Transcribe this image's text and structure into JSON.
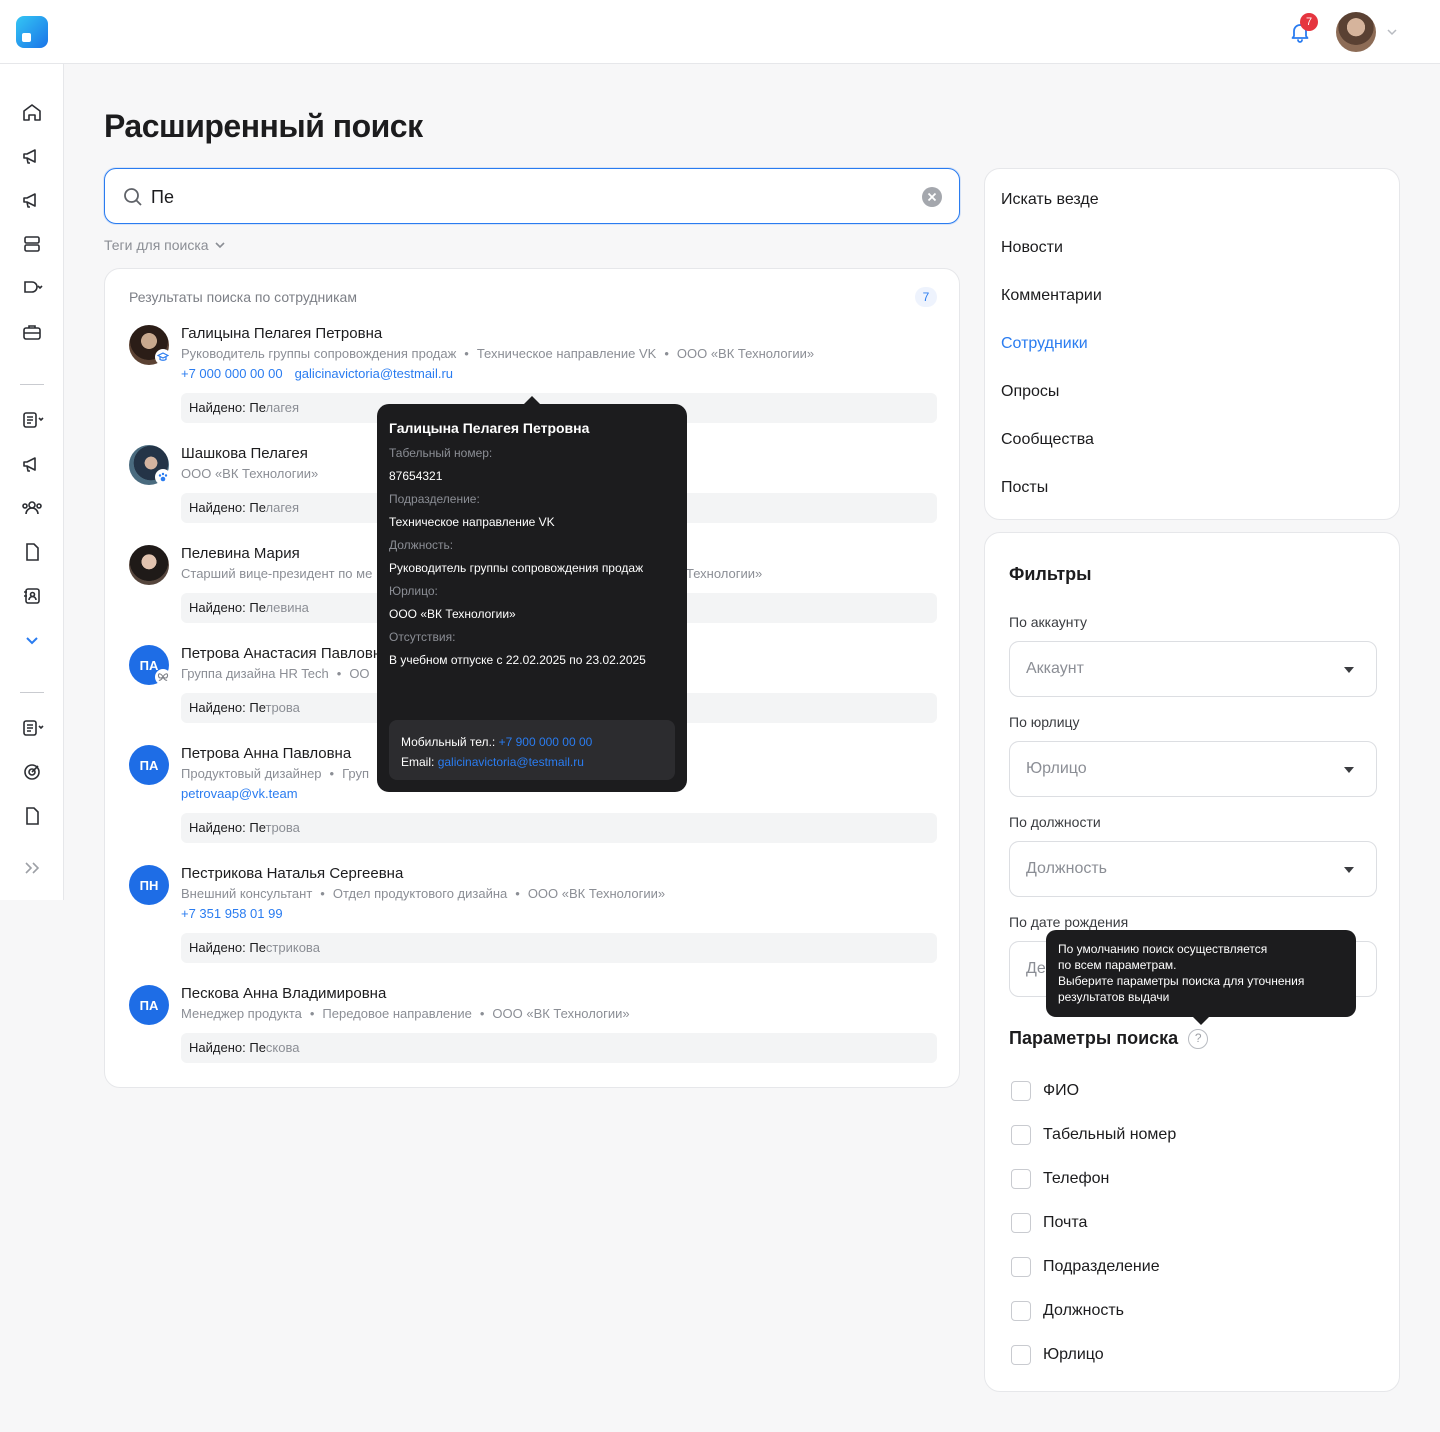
{
  "topbar": {
    "notifications_count": "7"
  },
  "page": {
    "title": "Расширенный поиск"
  },
  "search": {
    "value": "Пе",
    "tags_label": "Теги для поиска"
  },
  "results": {
    "heading": "Результаты поиска по сотрудникам",
    "count": "7",
    "people": [
      {
        "name": "Галицына Пелагея Петровна",
        "meta": [
          "Руководитель группы сопровождения продаж",
          "Техническое направление VK",
          "ООО «ВК Технологии»"
        ],
        "contacts": [
          "+7 000 000 00 00",
          "galicinavictoria@testmail.ru"
        ],
        "found_label": "Найдено:",
        "found_match": "Пе",
        "found_rest": "лагея"
      },
      {
        "name": "Шашкова Пелагея",
        "meta": [
          "ООО «ВК Технологии»"
        ],
        "contacts": [],
        "found_label": "Найдено:",
        "found_match": "Пе",
        "found_rest": "лагея"
      },
      {
        "name": "Пелевина Мария",
        "meta": [
          "Старший вице-президент по ме",
          "Технологии»"
        ],
        "contacts": [],
        "found_label": "Найдено:",
        "found_match": "Пе",
        "found_rest": "левина"
      },
      {
        "name": "Петрова Анастасия Павловн",
        "initials": "ПА",
        "meta": [
          "Группа дизайна HR Tech",
          "ОО"
        ],
        "contacts": [],
        "found_label": "Найдено:",
        "found_match": "Пе",
        "found_rest": "трова"
      },
      {
        "name": "Петрова Анна Павловна",
        "initials": "ПА",
        "meta": [
          "Продуктовый дизайнер",
          "Груп"
        ],
        "contacts": [
          "petrovaap@vk.team"
        ],
        "found_label": "Найдено:",
        "found_match": "Пе",
        "found_rest": "трова"
      },
      {
        "name": "Пестрикова Наталья Сергеевна",
        "initials": "ПН",
        "meta": [
          "Внешний консультант",
          "Отдел продуктового дизайна",
          "ООО «ВК Технологии»"
        ],
        "contacts": [
          "+7 351 958 01 99"
        ],
        "found_label": "Найдено:",
        "found_match": "Пе",
        "found_rest": "стрикова"
      },
      {
        "name": "Пескова Анна Владимировна",
        "initials": "ПА",
        "meta": [
          "Менеджер продукта",
          "Передовое направление",
          "ООО «ВК Технологии»"
        ],
        "contacts": [],
        "found_label": "Найдено:",
        "found_match": "Пе",
        "found_rest": "скова"
      }
    ]
  },
  "tooltip": {
    "name": "Галицына Пелагея Петровна",
    "tab_label": "Табельный номер:",
    "tab_value": "87654321",
    "dept_label": "Подразделение:",
    "dept_value": "Техническое направление VK",
    "pos_label": "Должность:",
    "pos_value": "Руководитель группы сопровождения продаж",
    "legal_label": "Юрлицо:",
    "legal_value": "ООО «ВК Технологии»",
    "abs_label": "Отсутствия:",
    "abs_value": "В учебном отпуске с 22.02.2025 по 23.02.2025",
    "mobile_label": "Мобильный тел.:",
    "mobile_value": "+7 900 000 00 00",
    "email_label": "Email:",
    "email_value": "galicinavictoria@testmail.ru"
  },
  "categories": [
    "Искать везде",
    "Новости",
    "Комментарии",
    "Сотрудники",
    "Опросы",
    "Сообщества",
    "Посты"
  ],
  "active_category": "Сотрудники",
  "filters": {
    "title": "Фильтры",
    "account_label": "По аккаунту",
    "account_placeholder": "Аккаунт",
    "legal_label": "По юрлицу",
    "legal_placeholder": "Юрлицо",
    "position_label": "По должности",
    "position_placeholder": "Должность",
    "birth_label": "По дате рождения",
    "birth_placeholder": "Де",
    "params_title": "Параметры поиска",
    "params": [
      "ФИО",
      "Табельный номер",
      "Телефон",
      "Почта",
      "Подразделение",
      "Должность",
      "Юрлицо"
    ]
  },
  "help_tooltip": {
    "lines": [
      "По умолчанию поиск осуществляется",
      "по всем параметрам.",
      "Выберите параметры поиска для уточнения",
      "результатов выдачи"
    ]
  },
  "colors": {
    "accent": "#2a7cf0",
    "tooltip_bg": "#1c1c1e",
    "avatar_initials_bg": "#1e6de6"
  }
}
